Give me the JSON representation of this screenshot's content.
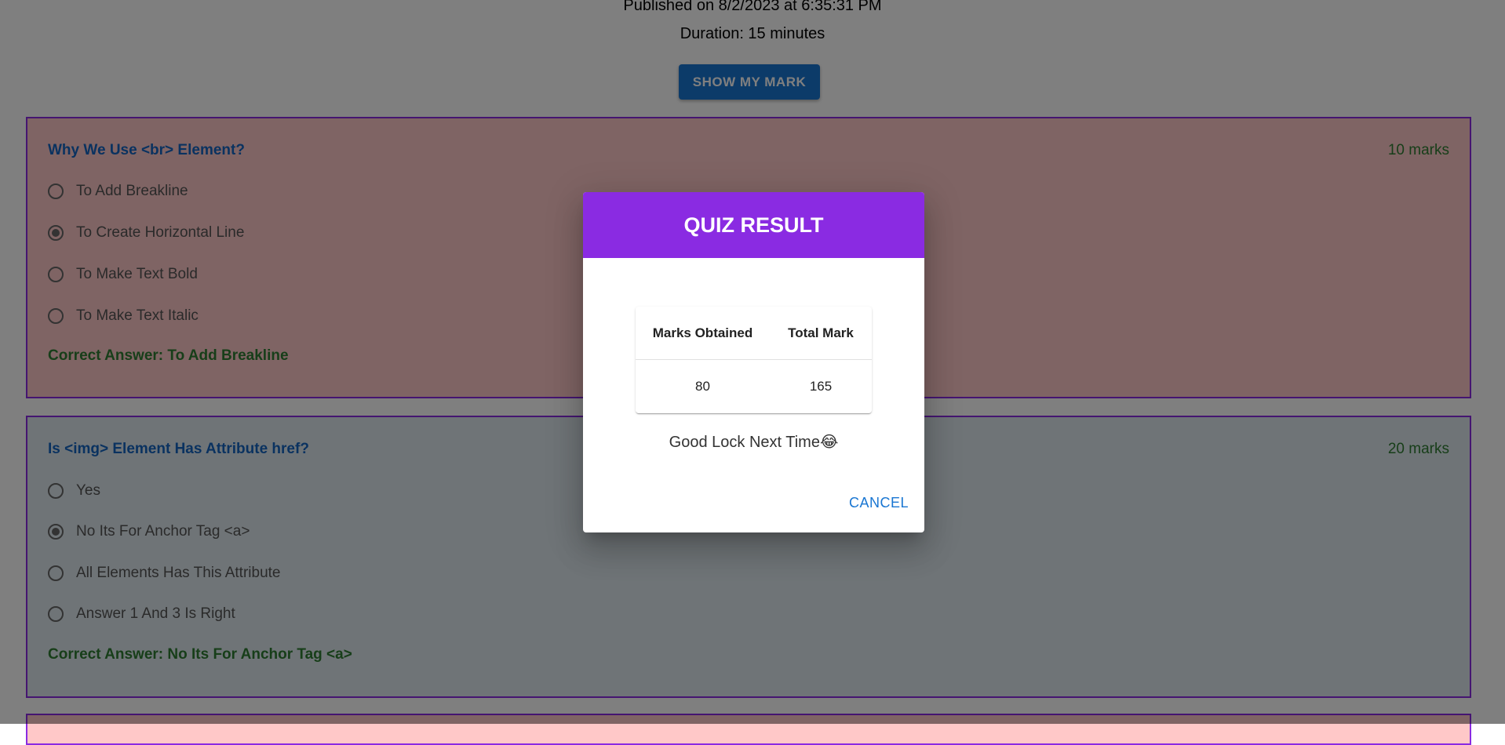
{
  "header": {
    "published": "Published on 8/2/2023 at 6:35:31 PM",
    "duration": "Duration: 15 minutes",
    "show_mark_label": "SHOW MY MARK"
  },
  "questions": [
    {
      "title": "Why We Use <br> Element?",
      "marks": "10 marks",
      "options": [
        "To Add Breakline",
        "To Create Horizontal Line",
        "To Make Text Bold",
        "To Make Text Italic"
      ],
      "selected_index": 1,
      "correct_answer": "Correct Answer: To Add Breakline"
    },
    {
      "title": "Is <img> Element Has Attribute href?",
      "marks": "20 marks",
      "options": [
        "Yes",
        "No Its For Anchor Tag <a>",
        "All Elements Has This Attribute",
        "Answer 1 And 3 Is Right"
      ],
      "selected_index": 1,
      "correct_answer": "Correct Answer: No Its For Anchor Tag <a>"
    }
  ],
  "dialog": {
    "title": "QUIZ RESULT",
    "table": {
      "headers": [
        "Marks Obtained",
        "Total Mark"
      ],
      "row": [
        "80",
        "165"
      ]
    },
    "message": "Good Lock Next Time😂",
    "cancel_label": "CANCEL"
  },
  "colors": {
    "accent": "#8a2be2",
    "primary": "#1976d2",
    "wrong_bg": "#ffc8c8",
    "neutral_bg": "#dfe8ee",
    "correct": "#2e7d32"
  }
}
